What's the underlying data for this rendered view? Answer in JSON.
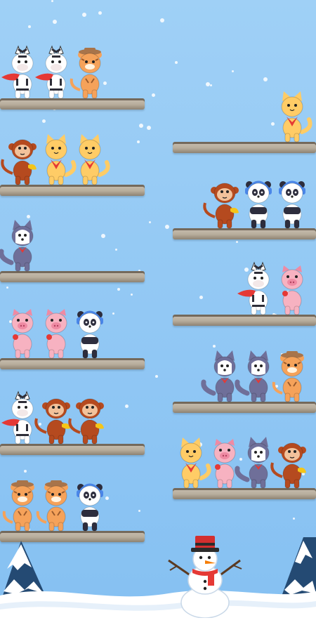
{
  "palette": {
    "sky": "#8dc6f4",
    "shelf_wood": "#bfb6a6",
    "snow": "#ffffff"
  },
  "animal_kinds": {
    "zebra": {
      "body": "#ffffff",
      "stripe": "#2e2e38",
      "accent": "#e53935"
    },
    "cat": {
      "body": "#ffcc66",
      "stripe": "#e9a83c",
      "accent": "#e53935"
    },
    "monkey": {
      "body": "#b54a1f",
      "stripe": "#f2c29b",
      "accent": "#f5c518"
    },
    "tiger": {
      "body": "#f5a25a",
      "stripe": "#9a5b2d",
      "accent": "#a8744a"
    },
    "husky": {
      "body": "#6f6f99",
      "stripe": "#ffffff",
      "accent": "#e53935"
    },
    "pig": {
      "body": "#f7b2c1",
      "stripe": "#ef8aa3",
      "accent": "#e53935"
    },
    "panda": {
      "body": "#ffffff",
      "stripe": "#2d2d3d",
      "accent": "#4a86e8"
    }
  },
  "shelves": [
    {
      "id": "L1",
      "animals": [
        "zebra",
        "zebra",
        "tiger"
      ]
    },
    {
      "id": "L2",
      "animals": [
        "monkey",
        "cat",
        "cat"
      ]
    },
    {
      "id": "L3",
      "animals": [
        "husky"
      ]
    },
    {
      "id": "L4",
      "animals": [
        "pig",
        "pig",
        "panda"
      ]
    },
    {
      "id": "L5",
      "animals": [
        "zebra",
        "monkey",
        "monkey"
      ]
    },
    {
      "id": "L6",
      "animals": [
        "tiger",
        "tiger",
        "panda"
      ]
    },
    {
      "id": "R1",
      "animals": [
        "cat"
      ]
    },
    {
      "id": "R2",
      "animals": [
        "monkey",
        "panda",
        "panda"
      ]
    },
    {
      "id": "R3",
      "animals": [
        "zebra",
        "pig"
      ]
    },
    {
      "id": "R4",
      "animals": [
        "husky",
        "husky",
        "tiger"
      ]
    },
    {
      "id": "R5",
      "animals": [
        "cat",
        "pig",
        "husky",
        "monkey"
      ]
    }
  ],
  "scenery": [
    "snowman",
    "snowy-pine-tree-left",
    "snowy-pine-tree-right",
    "snow-ground"
  ]
}
